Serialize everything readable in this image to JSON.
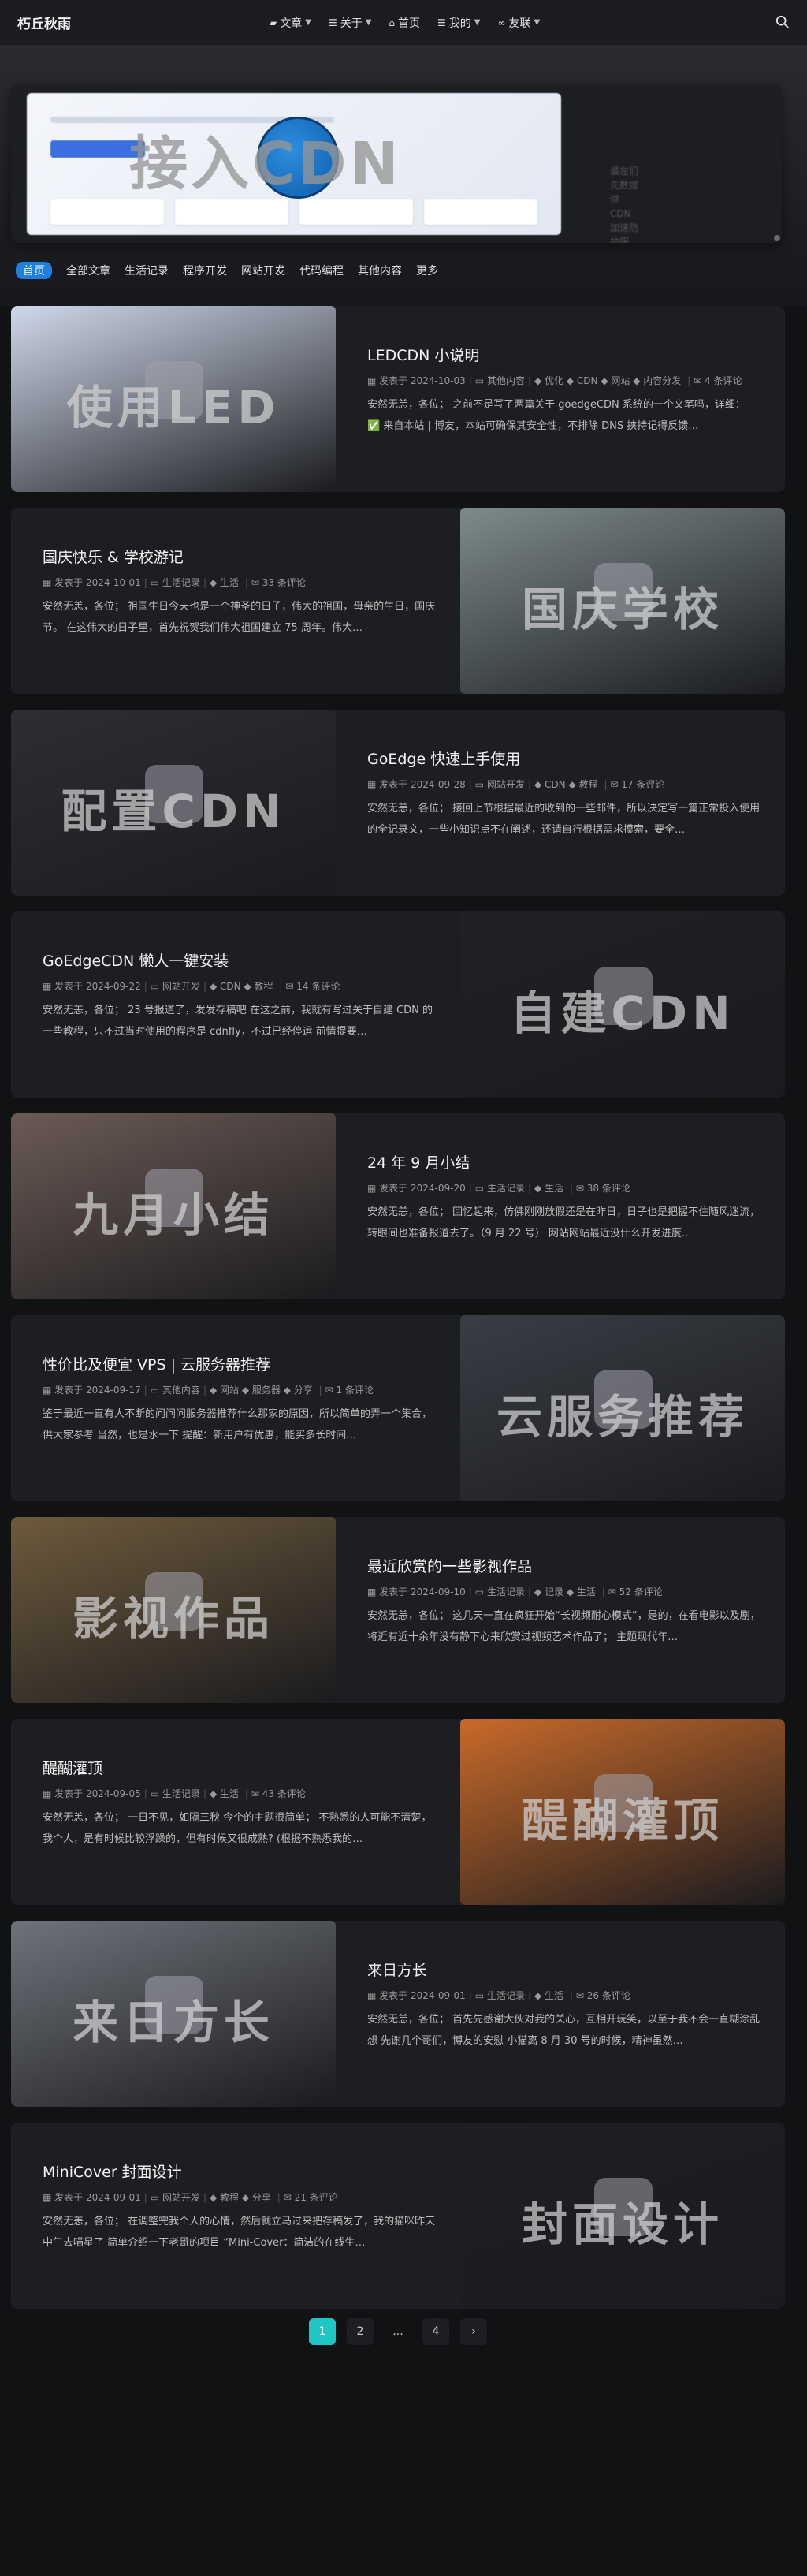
{
  "header": {
    "site_name": "朽丘秋雨",
    "nav": [
      {
        "icon": "folder-icon",
        "label": "文章",
        "dropdown": true
      },
      {
        "icon": "list-icon",
        "label": "关于",
        "dropdown": true
      },
      {
        "icon": "home-icon",
        "label": "首页",
        "dropdown": false
      },
      {
        "icon": "list-icon",
        "label": "我的",
        "dropdown": true
      },
      {
        "icon": "link-icon",
        "label": "友联",
        "dropdown": true
      }
    ]
  },
  "hero": {
    "title": "接入CDN",
    "side_text": "最左们先数提供 CDN 加速防护服务，免费提供"
  },
  "categories": [
    "首页",
    "全部文章",
    "生活记录",
    "程序开发",
    "网站开发",
    "代码编程",
    "其他内容",
    "更多"
  ],
  "posts": [
    {
      "title": "LEDCDN 小说明",
      "date": "2024-10-03",
      "category": "其他内容",
      "tags": [
        "优化",
        "CDN",
        "网站",
        "内容分发"
      ],
      "comments": "4 条评论",
      "excerpt": "安然无恙，各位； 之前不是写了两篇关于 goedgeCDN 系统的一个文笔吗，详细： ✅ 来自本站 | 博友，本站可确保其安全性，不排除 DNS 挟持记得反馈…",
      "cover_text": "使用LED",
      "layout": "left",
      "bg": "#cfd8ea"
    },
    {
      "title": "国庆快乐 & 学校游记",
      "date": "2024-10-01",
      "category": "生活记录",
      "tags": [
        "生活"
      ],
      "comments": "33 条评论",
      "excerpt": "安然无恙，各位； 祖国生日今天也是一个神圣的日子，伟大的祖国，母亲的生日，国庆节。 在这伟大的日子里，首先祝贺我们伟大祖国建立 75 周年。伟大…",
      "cover_text": "国庆学校",
      "layout": "right",
      "bg": "#7d8a8c"
    },
    {
      "title": "GoEdge 快速上手使用",
      "date": "2024-09-28",
      "category": "网站开发",
      "tags": [
        "CDN",
        "教程"
      ],
      "comments": "17 条评论",
      "excerpt": "安然无恙，各位； 接回上节根据最近的收到的一些邮件，所以决定写一篇正常投入使用的全记录文，一些小知识点不在阐述，还请自行根据需求摸索，要全…",
      "cover_text": "配置CDN",
      "layout": "left",
      "bg": "#2c2e33"
    },
    {
      "title": "GoEdgeCDN 懒人一键安装",
      "date": "2024-09-22",
      "category": "网站开发",
      "tags": [
        "CDN",
        "教程"
      ],
      "comments": "14 条评论",
      "excerpt": "安然无恙，各位； 23 号报道了，发发存稿吧 在这之前，我就有写过关于自建 CDN 的一些教程，只不过当时使用的程序是 cdnfly，不过已经停运 前情提要…",
      "cover_text": "自建CDN",
      "layout": "right",
      "bg": "#1f2124"
    },
    {
      "title": "24 年 9 月小结",
      "date": "2024-09-20",
      "category": "生活记录",
      "tags": [
        "生活"
      ],
      "comments": "38 条评论",
      "excerpt": "安然无恙，各位； 回忆起来，仿佛刚刚放假还是在昨日，日子也是把握不住随风迷流，转眼间也准备报道去了。（9 月 22 号） 网站网站最近没什么开发进度…",
      "cover_text": "九月小结",
      "layout": "left",
      "bg": "#6b5a55"
    },
    {
      "title": "性价比及便宜 VPS | 云服务器推荐",
      "date": "2024-09-17",
      "category": "其他内容",
      "tags": [
        "网站",
        "服务器",
        "分享"
      ],
      "comments": "1 条评论",
      "excerpt": "鉴于最近一直有人不断的问问问服务器推荐什么那家的原因，所以简单的弄一个集合，供大家参考 当然，也是水一下 提醒：新用户有优惠，能买多长时间…",
      "cover_text": "云服务推荐",
      "layout": "right",
      "bg": "#3a3d44"
    },
    {
      "title": "最近欣赏的一些影视作品",
      "date": "2024-09-10",
      "category": "生活记录",
      "tags": [
        "记录",
        "生活"
      ],
      "comments": "52 条评论",
      "excerpt": "安然无恙，各位； 这几天一直在疯狂开始“长视频耐心模式”，是的，在看电影以及剧，将近有近十余年没有静下心来欣赏过视频艺术作品了； 主题现代年…",
      "cover_text": "影视作品",
      "layout": "left",
      "bg": "#6e5a3c"
    },
    {
      "title": "醍醐灌顶",
      "date": "2024-09-05",
      "category": "生活记录",
      "tags": [
        "生活"
      ],
      "comments": "43 条评论",
      "excerpt": "安然无恙，各位； 一日不见，如隔三秋 今个的主题很简单； 不熟悉的人可能不清楚，我个人，是有时候比较浮躁的，但有时候又很成熟? (根据不熟悉我的…",
      "cover_text": "醍醐灌顶",
      "layout": "right",
      "bg": "#c86a2a"
    },
    {
      "title": "来日方长",
      "date": "2024-09-01",
      "category": "生活记录",
      "tags": [
        "生活"
      ],
      "comments": "26 条评论",
      "excerpt": "安然无恙，各位； 首先先感谢大伙对我的关心，互相开玩笑，以至于我不会一直糊涂乱想 先谢几个哥们，博友的安慰 小猫离 8 月 30 号的时候，精神虽然…",
      "cover_text": "来日方长",
      "layout": "left",
      "bg": "#6f7279"
    },
    {
      "title": "MiniCover 封面设计",
      "date": "2024-09-01",
      "category": "网站开发",
      "tags": [
        "教程",
        "分享"
      ],
      "comments": "21 条评论",
      "excerpt": "安然无恙，各位； 在调整完我个人的心情，然后就立马过来把存稿发了，我的猫咪昨天中午去喵星了 简单介绍一下老哥的项目 “Mini-Cover：简洁的在线生…",
      "cover_text": "封面设计",
      "layout": "right",
      "bg": "#1e1f23"
    }
  ],
  "meta_labels": {
    "posted": "发表于"
  },
  "pagination": [
    "1",
    "2",
    "...",
    "4",
    "›"
  ]
}
